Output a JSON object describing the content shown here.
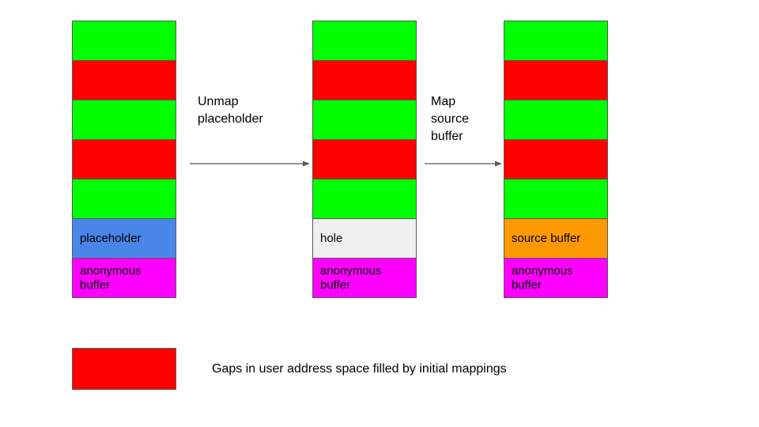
{
  "diagram": {
    "colors": {
      "gap": "#ff0000",
      "mapped_region": "#00ff00",
      "placeholder": "#4a86e8",
      "hole": "#efefef",
      "source_buffer": "#ff9900",
      "anonymous_buffer": "#ff00ff",
      "border": "#595959",
      "arrow": "#595959",
      "text": "#000000"
    },
    "columns": [
      {
        "id": "initial",
        "bands": [
          {
            "label": "",
            "fill": "green",
            "lines": 1
          },
          {
            "label": "",
            "fill": "red",
            "lines": 1
          },
          {
            "label": "",
            "fill": "green",
            "lines": 1
          },
          {
            "label": "",
            "fill": "red",
            "lines": 1
          },
          {
            "label": "",
            "fill": "green",
            "lines": 1
          },
          {
            "label": "placeholder",
            "fill": "blue",
            "lines": 1
          },
          {
            "label": "anonymous\nbuffer",
            "fill": "magenta",
            "lines": 2
          }
        ]
      },
      {
        "id": "unmapped",
        "bands": [
          {
            "label": "",
            "fill": "green",
            "lines": 1
          },
          {
            "label": "",
            "fill": "red",
            "lines": 1
          },
          {
            "label": "",
            "fill": "green",
            "lines": 1
          },
          {
            "label": "",
            "fill": "red",
            "lines": 1
          },
          {
            "label": "",
            "fill": "green",
            "lines": 1
          },
          {
            "label": "hole",
            "fill": "gray",
            "lines": 1
          },
          {
            "label": "anonymous\nbuffer",
            "fill": "magenta",
            "lines": 2
          }
        ]
      },
      {
        "id": "mapped",
        "bands": [
          {
            "label": "",
            "fill": "green",
            "lines": 1
          },
          {
            "label": "",
            "fill": "red",
            "lines": 1
          },
          {
            "label": "",
            "fill": "green",
            "lines": 1
          },
          {
            "label": "",
            "fill": "red",
            "lines": 1
          },
          {
            "label": "",
            "fill": "green",
            "lines": 1
          },
          {
            "label": "source buffer",
            "fill": "orange",
            "lines": 1
          },
          {
            "label": "anonymous\nbuffer",
            "fill": "magenta",
            "lines": 2
          }
        ]
      }
    ],
    "transitions": [
      {
        "id": "unmap",
        "label": "Unmap\nplaceholder"
      },
      {
        "id": "map",
        "label": "Map\nsource\nbuffer"
      }
    ],
    "legend": {
      "swatch_color": "#ff0000",
      "caption": "Gaps in user address space filled by initial mappings"
    }
  }
}
